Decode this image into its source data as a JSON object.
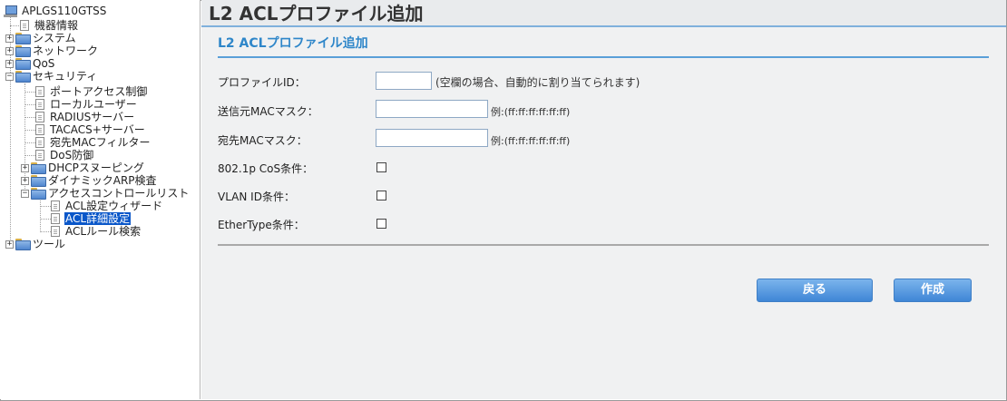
{
  "tree": {
    "root": "APLGS110GTSS",
    "items": [
      {
        "label": "機器情報"
      },
      {
        "label": "システム"
      },
      {
        "label": "ネットワーク"
      },
      {
        "label": "QoS"
      },
      {
        "label": "セキュリティ"
      },
      {
        "label": "ポートアクセス制御"
      },
      {
        "label": "ローカルユーザー"
      },
      {
        "label": "RADIUSサーバー"
      },
      {
        "label": "TACACS+サーバー"
      },
      {
        "label": "宛先MACフィルター"
      },
      {
        "label": "DoS防御"
      },
      {
        "label": "DHCPスヌーピング"
      },
      {
        "label": "ダイナミックARP検査"
      },
      {
        "label": "アクセスコントロールリスト"
      },
      {
        "label": "ACL設定ウィザード"
      },
      {
        "label": "ACL詳細設定"
      },
      {
        "label": "ACLルール検索"
      },
      {
        "label": "ツール"
      }
    ]
  },
  "main": {
    "title": "L2 ACLプロファイル追加",
    "section_title": "L2 ACLプロファイル追加",
    "fields": {
      "profile_id": {
        "label": "プロファイルID：",
        "value": "",
        "hint": "(空欄の場合、自動的に割り当てられます)"
      },
      "src_mac": {
        "label": "送信元MACマスク：",
        "value": "",
        "hint": "例:(ff:ff:ff:ff:ff:ff)"
      },
      "dst_mac": {
        "label": "宛先MACマスク：",
        "value": "",
        "hint": "例:(ff:ff:ff:ff:ff:ff)"
      },
      "cos": {
        "label": "802.1p CoS条件：",
        "checked": false
      },
      "vlan": {
        "label": "VLAN ID条件：",
        "checked": false
      },
      "ethertype": {
        "label": "EtherType条件：",
        "checked": false
      }
    },
    "buttons": {
      "back": "戻る",
      "create": "作成"
    }
  },
  "colors": {
    "accent": "#2e86c9",
    "selection": "#0a57c9",
    "button": "#3f86d6"
  }
}
